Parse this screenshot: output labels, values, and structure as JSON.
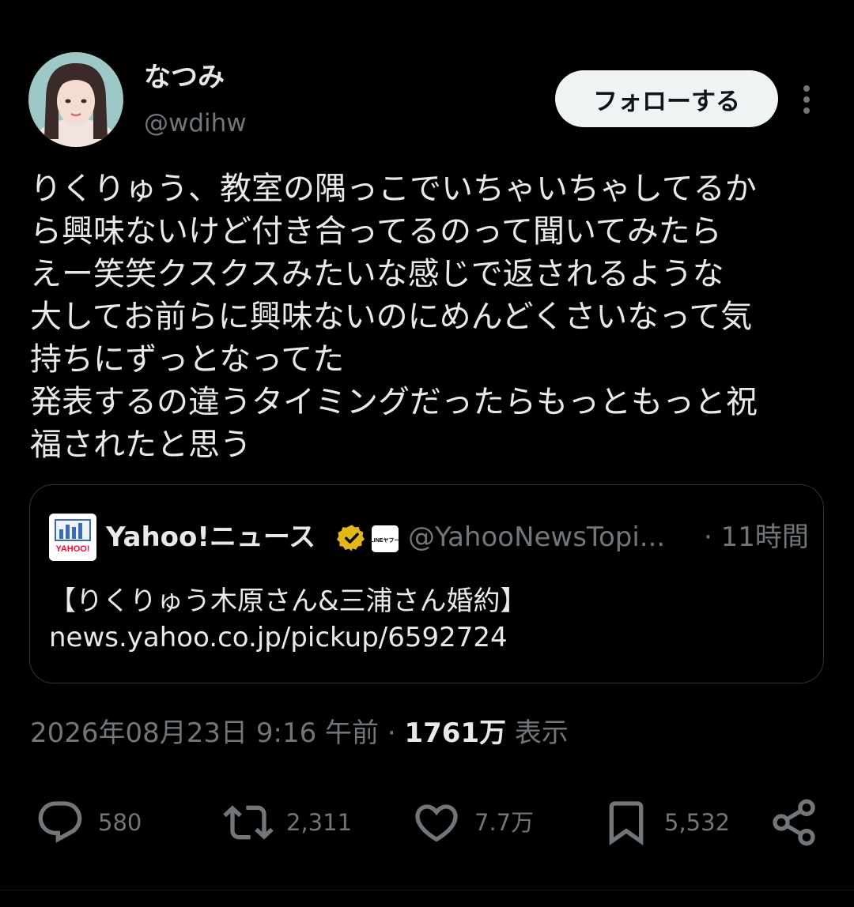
{
  "author": {
    "display_name": "なつみ",
    "handle": "@wdihw"
  },
  "follow_label": "フォローする",
  "tweet_text": "りくりゅう、教室の隅っこでいちゃいちゃしてるか\nら興味ないけど付き合ってるのって聞いてみたら\nえー笑笑クスクスみたいな感じで返されるような\n大してお前らに興味ないのにめんどくさいなって気\n持ちにずっとなってた\n発表するの違うタイミングだったらもっともっと祝\n福されたと思う",
  "quote": {
    "name": "Yahoo!ニュース",
    "handle": "@YahooNewsTopi...",
    "time": "· 11時間",
    "text": "【りくりゅう木原さん&三浦さん婚約】\nnews.yahoo.co.jp/pickup/6592724",
    "logo_label": "YAHOO!",
    "badge_label": "LINEヤフー"
  },
  "meta": {
    "datetime": "2026年08月23日 9:16 午前",
    "separator": " · ",
    "views_count": "1761万",
    "views_label": " 表示"
  },
  "actions": {
    "reply": "580",
    "retweet": "2,311",
    "like": "7.7万",
    "bookmark": "5,532"
  },
  "colors": {
    "background": "#000000",
    "text": "#e7e9ea",
    "secondary": "#71767b",
    "verified_gold": "#e2b719"
  }
}
